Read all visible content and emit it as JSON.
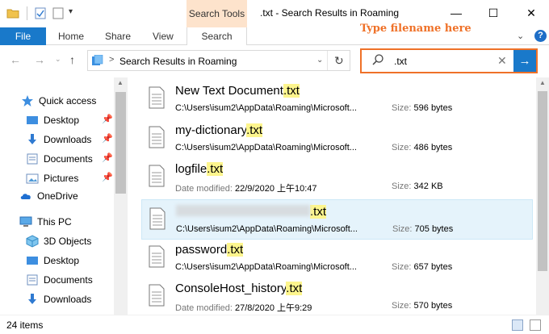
{
  "window": {
    "title": ".txt - Search Results in Roaming",
    "contextual_tab": "Search Tools",
    "minimize": "—",
    "maximize": "☐",
    "close": "✕"
  },
  "ribbon": {
    "file": "File",
    "home": "Home",
    "share": "Share",
    "view": "View",
    "search": "Search",
    "chevron": "⌄",
    "help": "?"
  },
  "annotation": "Type filename here",
  "address": {
    "location": "Search Results in Roaming",
    "separator": ">",
    "back": "←",
    "forward": "→",
    "recent": "⌄",
    "up": "↑",
    "dropdown": "⌄",
    "refresh": "↻"
  },
  "search": {
    "value": ".txt",
    "clear": "✕",
    "go": "→"
  },
  "sidebar": {
    "items": [
      {
        "label": "Quick access",
        "icon": "star-icon",
        "pinned": false
      },
      {
        "label": "Desktop",
        "icon": "desktop-icon",
        "pinned": true
      },
      {
        "label": "Downloads",
        "icon": "download-icon",
        "pinned": true
      },
      {
        "label": "Documents",
        "icon": "documents-icon",
        "pinned": true
      },
      {
        "label": "Pictures",
        "icon": "pictures-icon",
        "pinned": true
      },
      {
        "label": "OneDrive",
        "icon": "cloud-icon",
        "pinned": false
      },
      {
        "label": "This PC",
        "icon": "computer-icon",
        "pinned": false
      },
      {
        "label": "3D Objects",
        "icon": "cube-icon",
        "pinned": false
      },
      {
        "label": "Desktop",
        "icon": "desktop-icon",
        "pinned": false
      },
      {
        "label": "Documents",
        "icon": "documents-icon",
        "pinned": false
      },
      {
        "label": "Downloads",
        "icon": "download-icon",
        "pinned": false
      }
    ],
    "pin_glyph": "📌"
  },
  "results": [
    {
      "name": "New Text Document",
      "ext": ".txt",
      "meta_label": "",
      "meta": "C:\\Users\\isum2\\AppData\\Roaming\\Microsoft...",
      "size_label": "Size:",
      "size": "596 bytes",
      "selected": false,
      "blurred": false
    },
    {
      "name": "my-dictionary",
      "ext": ".txt",
      "meta_label": "",
      "meta": "C:\\Users\\isum2\\AppData\\Roaming\\Microsoft...",
      "size_label": "Size:",
      "size": "486 bytes",
      "selected": false,
      "blurred": false
    },
    {
      "name": "logfile",
      "ext": ".txt",
      "meta_label": "Date modified:",
      "meta": "22/9/2020 上午10:47",
      "size_label": "Size:",
      "size": "342 KB",
      "selected": false,
      "blurred": false
    },
    {
      "name": "",
      "ext": ".txt",
      "meta_label": "",
      "meta": "C:\\Users\\isum2\\AppData\\Roaming\\Microsoft...",
      "size_label": "Size:",
      "size": "705 bytes",
      "selected": true,
      "blurred": true
    },
    {
      "name": "password",
      "ext": ".txt",
      "meta_label": "",
      "meta": "C:\\Users\\isum2\\AppData\\Roaming\\Microsoft...",
      "size_label": "Size:",
      "size": "657 bytes",
      "selected": false,
      "blurred": false
    },
    {
      "name": "ConsoleHost_history",
      "ext": ".txt",
      "meta_label": "Date modified:",
      "meta": "27/8/2020 上午9:29",
      "size_label": "Size:",
      "size": "570 bytes",
      "selected": false,
      "blurred": false
    }
  ],
  "status": {
    "count": "24 items"
  },
  "colors": {
    "accent": "#1979ca",
    "annotation": "#ef7128",
    "highlight": "#fdf58d",
    "selected_row": "#e5f3fb",
    "contextual_tab": "#fde3cc"
  }
}
